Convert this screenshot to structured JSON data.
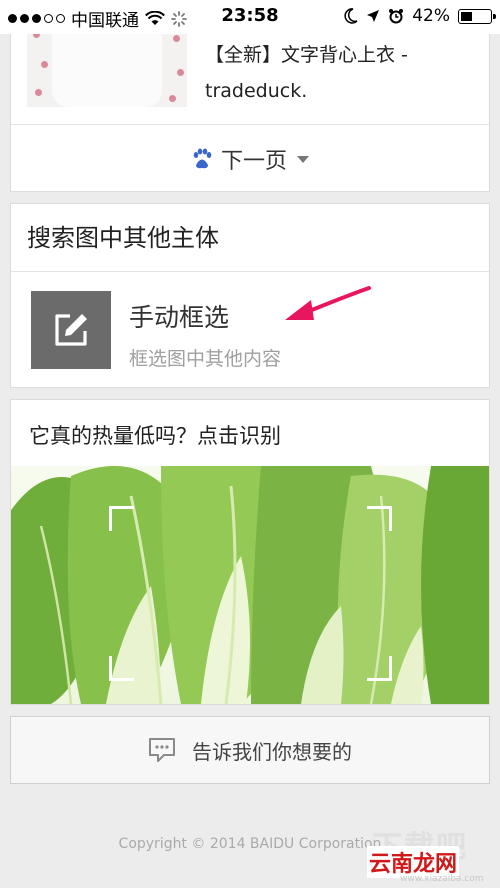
{
  "status_bar": {
    "carrier": "中国联通",
    "time": "23:58",
    "battery": "42%",
    "battery_level": 0.42
  },
  "result": {
    "title": "【全新】文字背心上衣 - tradeduck.",
    "next_page_label": "下一页"
  },
  "subject_search": {
    "header": "搜索图中其他主体",
    "manual_title": "手动框选",
    "manual_subtitle": "框选图中其他内容"
  },
  "calorie": {
    "title": "它真的热量低吗？点击识别"
  },
  "feedback": {
    "label": "告诉我们你想要的"
  },
  "footer": {
    "copyright": "Copyright © 2014 BAIDU Corporation"
  },
  "watermark": {
    "text_1": "下载吧",
    "text_2": "云南龙网",
    "text_3": "www.xiazaiba.com"
  },
  "colors": {
    "accent_blue": "#3a66c9",
    "arrow_pink": "#e8175d",
    "icon_gray": "#6b6b6b"
  },
  "icons": [
    "wifi-icon",
    "loading-icon",
    "moon-icon",
    "location-icon",
    "alarm-icon",
    "battery-icon",
    "baidu-paw-icon",
    "dropdown-caret-icon",
    "edit-icon",
    "arrow-icon",
    "chat-icon"
  ]
}
